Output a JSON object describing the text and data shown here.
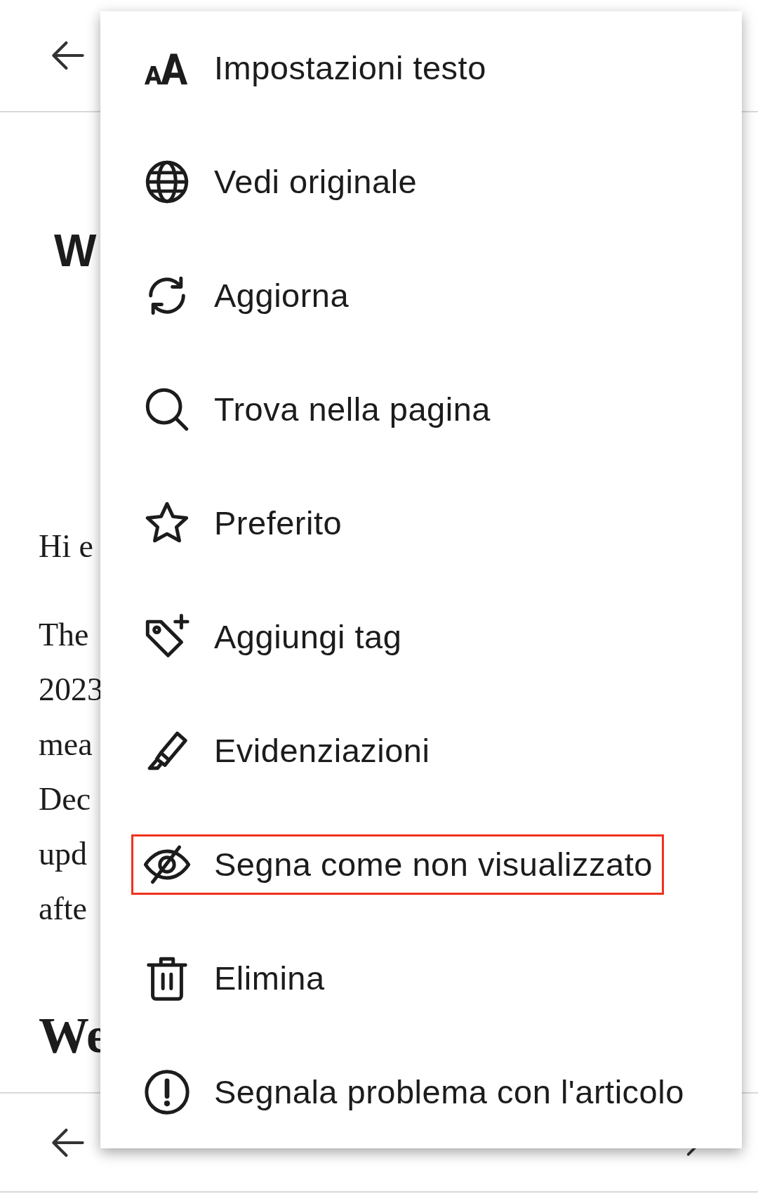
{
  "article": {
    "heading": "W",
    "paragraphs": [
      "Hi e"
    ],
    "lines": [
      "The",
      "2023",
      "mea",
      "Dec",
      "upd",
      "afte"
    ],
    "subheading": "We"
  },
  "menu": {
    "items": [
      {
        "label": "Impostazioni testo",
        "highlighted": false
      },
      {
        "label": "Vedi originale",
        "highlighted": false
      },
      {
        "label": "Aggiorna",
        "highlighted": false
      },
      {
        "label": "Trova nella pagina",
        "highlighted": false
      },
      {
        "label": "Preferito",
        "highlighted": false
      },
      {
        "label": "Aggiungi tag",
        "highlighted": false
      },
      {
        "label": "Evidenziazioni",
        "highlighted": false
      },
      {
        "label": "Segna come non visualizzato",
        "highlighted": true
      },
      {
        "label": "Elimina",
        "highlighted": false
      },
      {
        "label": "Segnala problema con l'articolo",
        "highlighted": false
      }
    ]
  }
}
